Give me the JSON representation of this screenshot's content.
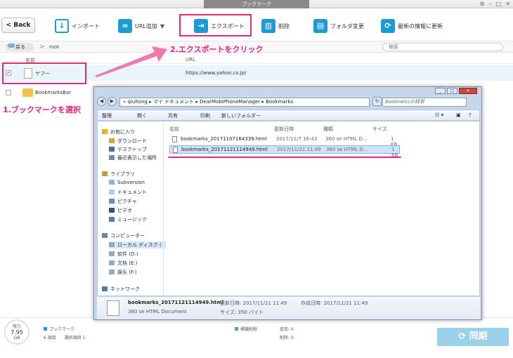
{
  "window": {
    "title": "ブックマーク"
  },
  "toolbar": {
    "back_label": "Back",
    "import_label": "インポート",
    "add_url_label": "URL追加",
    "export_label": "エクスポート",
    "delete_label": "削除",
    "rename_label": "フォルダ変更",
    "refresh_label": "最新の情報に更新"
  },
  "pathbar": {
    "back_label": "戻る",
    "path": "root",
    "search_placeholder": "検索"
  },
  "columns": {
    "name": "名前",
    "url": "URL"
  },
  "rows": [
    {
      "name": "ヤフー",
      "url": "https://www.yahoo.co.jp/",
      "checked": true
    },
    {
      "name": "BookmarksBar",
      "url": ""
    }
  ],
  "annotations": {
    "step1": "1.ブックマークを選択",
    "step2": "2.エクスポートをクリック"
  },
  "status": {
    "storage_label": "残り",
    "storage_value": "7.95",
    "storage_unit": "GB",
    "category": "ブックマーク",
    "item_count": "6 項目",
    "selected_count": "選択項目 1",
    "marked_delete": "標識削除",
    "added": "追加: 0",
    "deleted": "削除: 0",
    "sync_label": "同期",
    "sync_icon": "sync-icon"
  },
  "explorer": {
    "address_prefix": "«",
    "address_parts": [
      "qiuhong",
      "マイ ドキュメント",
      "DearMobiPhoneManager",
      "Bookmarks"
    ],
    "search_placeholder": "Bookmarksの検索",
    "cmd": {
      "organize": "整理",
      "open": "開く",
      "share": "共有",
      "print": "印刷",
      "new_folder": "新しいフォルダー"
    },
    "nav": {
      "favorites": "お気に入り",
      "downloads": "ダウンロード",
      "desktop": "デスクトップ",
      "recent": "最近表示した場所",
      "library": "ライブラリ",
      "subversion": "Subversion",
      "documents": "ドキュメント",
      "pictures": "ピクチャ",
      "videos": "ビデオ",
      "music": "ミュージック",
      "computer": "コンピューター",
      "local_disk": "ローカル ディスク (",
      "drive_d": "软件 (D:)",
      "drive_e": "文档 (E:)",
      "drive_f": "娱乐 (F:)",
      "network": "ネットワーク"
    },
    "headers": {
      "name": "名前",
      "modified": "更新日時",
      "type": "種類",
      "size": "サイズ"
    },
    "files": [
      {
        "name": "bookmarks_20171107164339.html",
        "modified": "2017/11/7 16:43",
        "type": "360 se HTML D...",
        "size": "1 KB"
      },
      {
        "name": "bookmarks_20171121114949.html",
        "modified": "2017/11/21 11:49",
        "type": "360 se HTML D...",
        "size": "1 KB"
      }
    ],
    "details": {
      "filename": "bookmarks_20171121114949.html",
      "modified_label": "更新日時: 2017/11/21 11:49",
      "created_label": "作成日時: 2017/11/21 11:49",
      "type": "360 se HTML Document",
      "size_label": "サイズ: 350 バイト"
    }
  }
}
